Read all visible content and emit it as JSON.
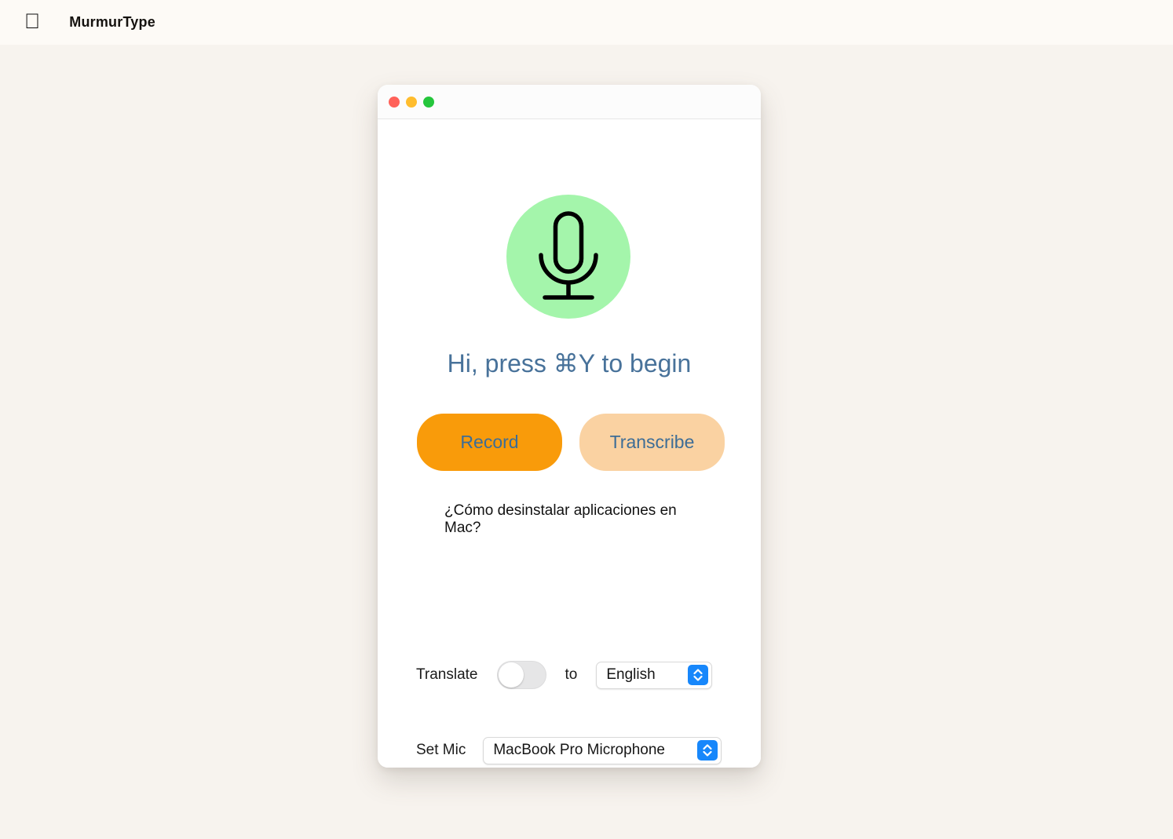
{
  "desktop": {
    "background_color": "#f7f3ee"
  },
  "menubar": {
    "apple_logo": "",
    "app_name": "MurmurType",
    "background_color": "#fdfaf6"
  },
  "window": {
    "traffic_lights": [
      {
        "name": "close",
        "color": "#ff6159"
      },
      {
        "name": "minimize",
        "color": "#ffbd2e"
      },
      {
        "name": "maximize",
        "color": "#25c63c"
      }
    ],
    "mic_badge": {
      "icon": "microphone-icon",
      "circle_color": "#a4f5ab",
      "icon_color": "#000000"
    },
    "greeting": "Hi, press ⌘Y to begin",
    "greeting_color": "#48729a",
    "buttons": [
      {
        "name": "record",
        "label": "Record",
        "color": "#f99b0a",
        "text_color": "#3d6d96"
      },
      {
        "name": "transcribe",
        "label": "Transcribe",
        "color": "#fad2a2",
        "text_color": "#3d6d96"
      }
    ],
    "transcript": "¿Cómo desinstalar aplicaciones en Mac?",
    "translate": {
      "label": "Translate",
      "toggle_state": "off",
      "to_label": "to",
      "language_selected": "English",
      "language_options": [
        "English"
      ]
    },
    "mic": {
      "label": "Set Mic",
      "selected": "MacBook Pro Microphone",
      "options": [
        "MacBook Pro Microphone"
      ]
    },
    "stepper_color": "#1787fb"
  }
}
